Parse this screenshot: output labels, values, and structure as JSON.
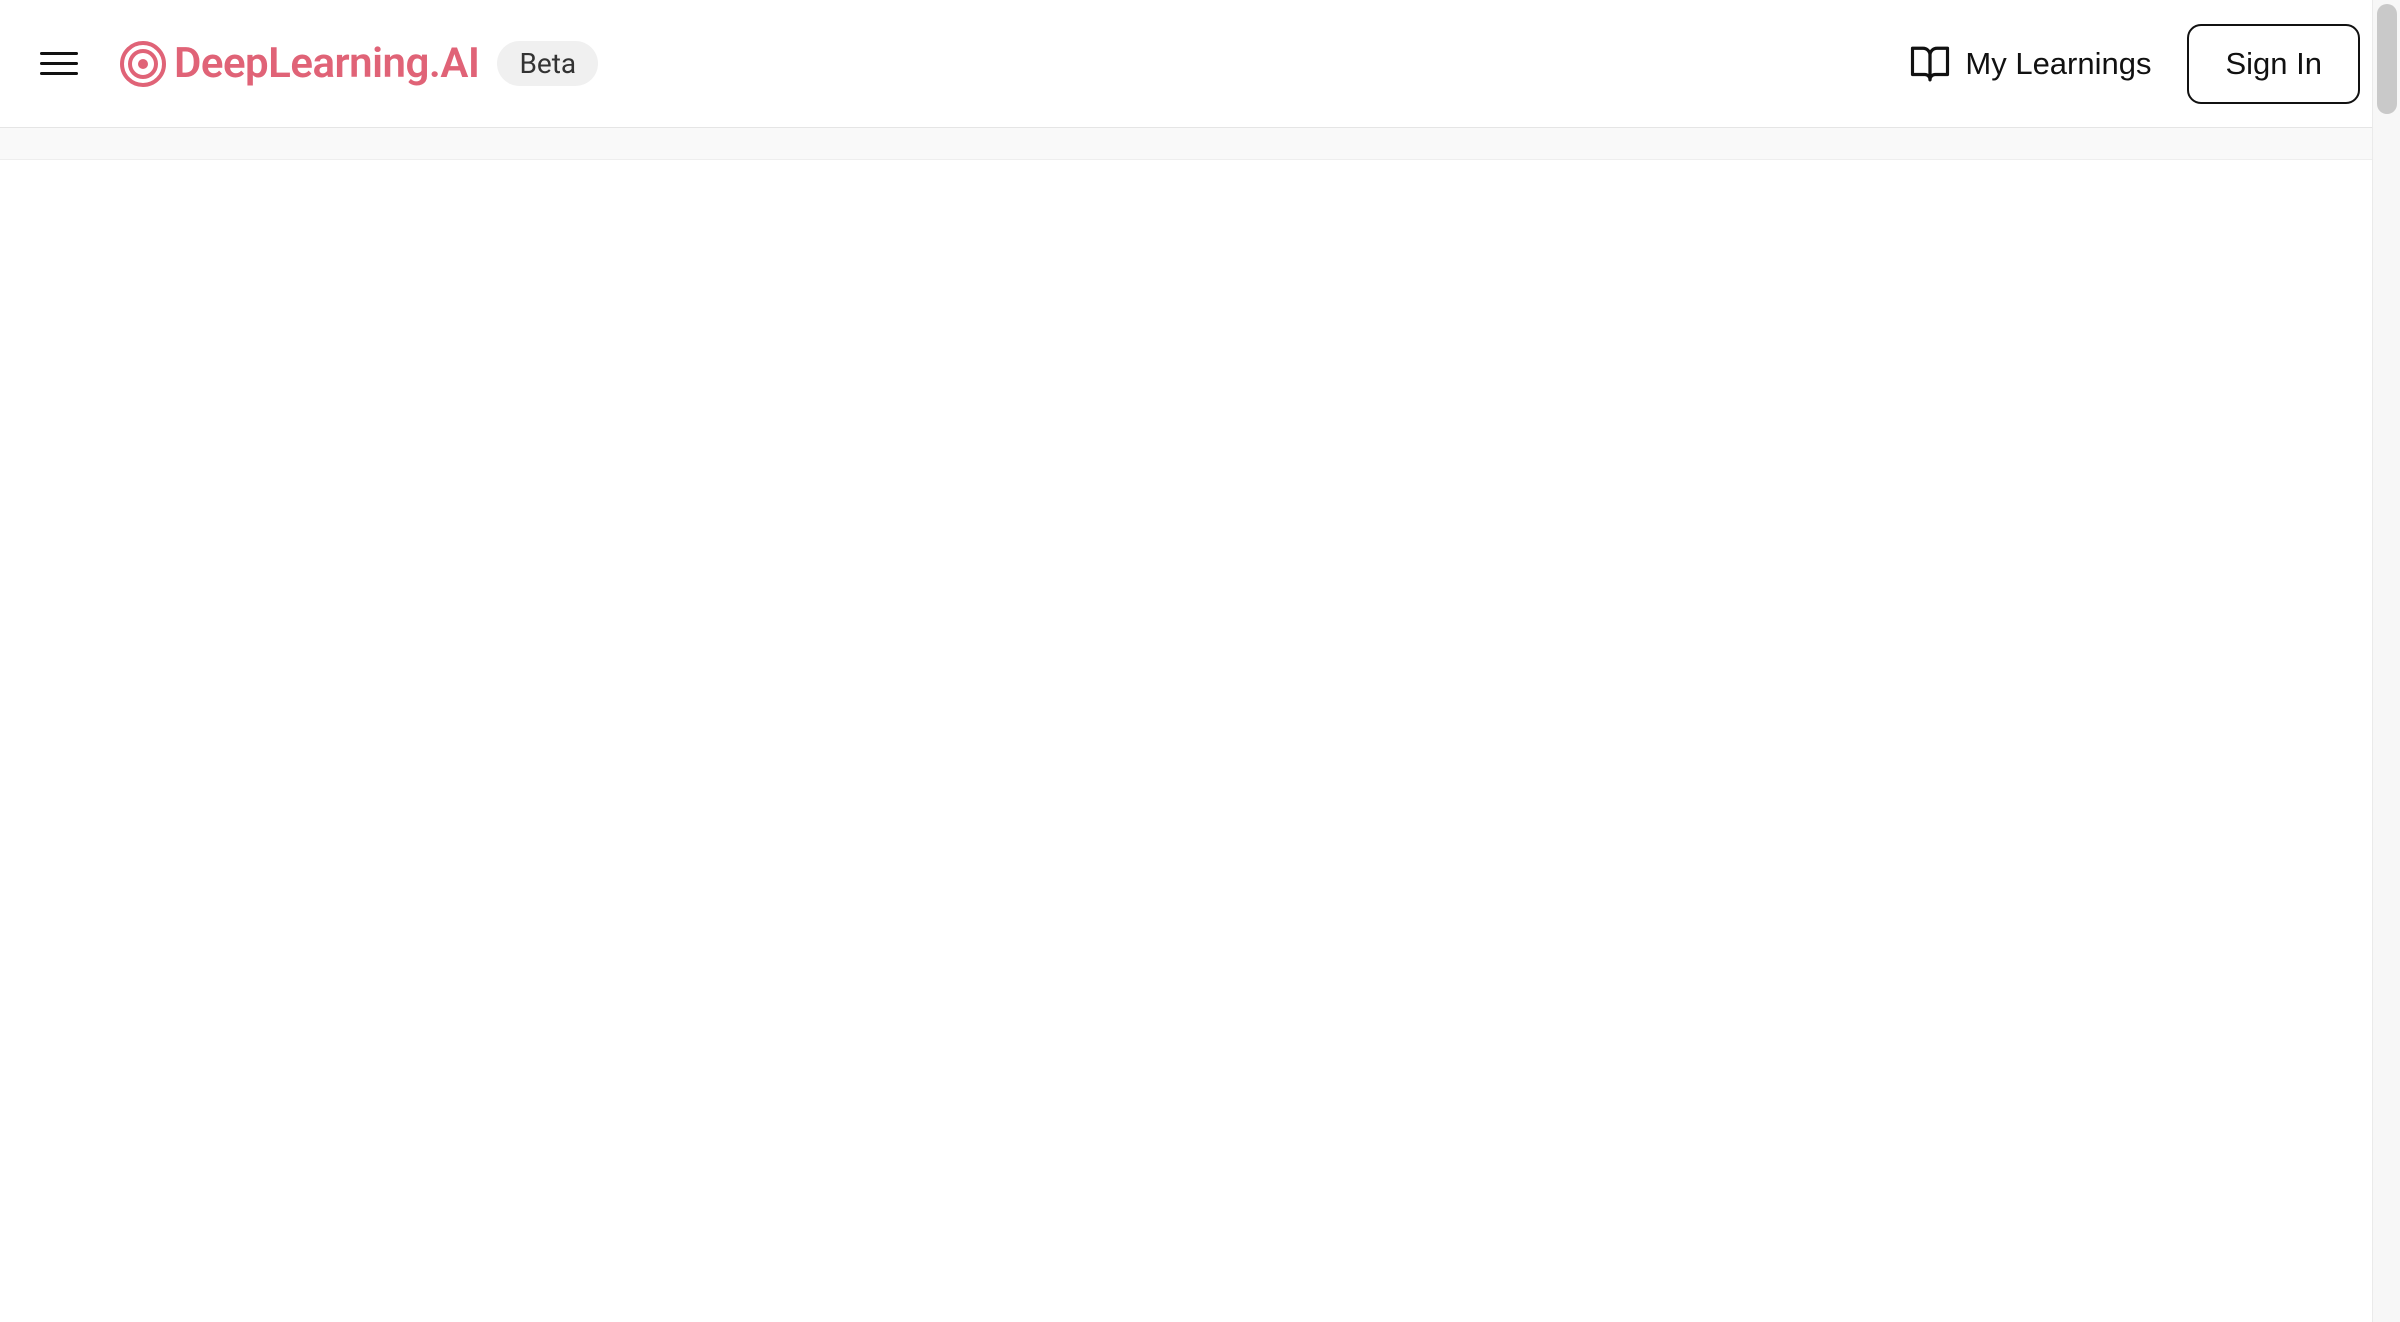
{
  "header": {
    "logo_text": "DeepLearning.AI",
    "beta_label": "Beta",
    "my_learnings_label": "My Learnings",
    "sign_in_label": "Sign In"
  },
  "colors": {
    "brand": "#e06377",
    "text": "#111111",
    "badge_bg": "#f0f0f0"
  }
}
